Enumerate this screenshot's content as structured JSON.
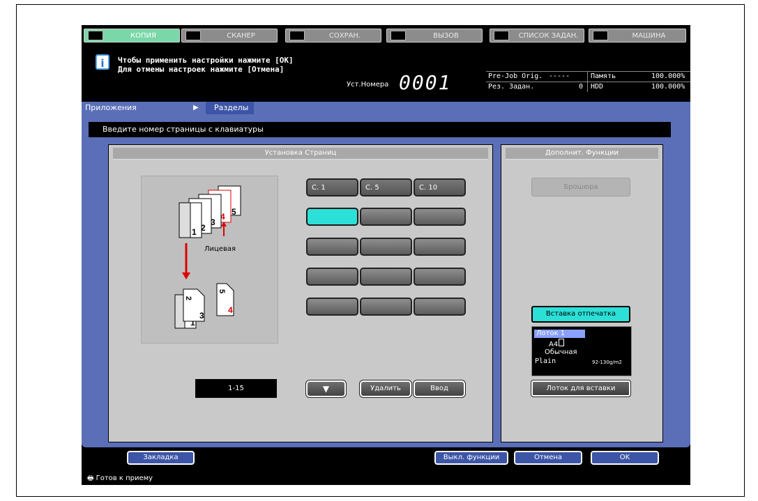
{
  "tabs": [
    {
      "label": "КОПИЯ",
      "icon": "copy-icon",
      "active": true
    },
    {
      "label": "СКАНЕР",
      "icon": "scanner-icon"
    },
    {
      "label": "СОХРАН.",
      "icon": "save-icon"
    },
    {
      "label": "ВЫЗОВ",
      "icon": "recall-icon"
    },
    {
      "label": "СПИСОК ЗАДАН.",
      "icon": "list-icon"
    },
    {
      "label": "МАШИНА",
      "icon": "machine-icon"
    }
  ],
  "message": {
    "line1": "Чтобы применить настройки нажмите [OK]",
    "line2": "Для отмены настроек нажмите [Отмена]",
    "set_label": "Уст.Номера",
    "set_value": "0001"
  },
  "status": {
    "prejob_label": "Pre-Job Orig.",
    "prejob_value": "-----",
    "memory_label": "Память",
    "memory_value": "100.000%",
    "res_label": "Рез. Задан.",
    "res_value": "0",
    "hdd_label": "HDD",
    "hdd_value": "100.000%"
  },
  "breadcrumb": {
    "parent": "Приложения",
    "current": "Разделы"
  },
  "instruction": "Введите номер страницы с клавиатуры",
  "page_setup": {
    "title": "Установка Страниц",
    "face_label": "Лицевая",
    "page_buttons": [
      "С.   1",
      "С.   5",
      "С.   10"
    ],
    "range": "1-15",
    "delete_label": "Удалить",
    "enter_label": "Ввод"
  },
  "extra": {
    "title": "Дополнит. Функции",
    "brochure_label": "Брошюра",
    "insert_label": "Вставка отпечатка",
    "tray": {
      "name": "Лоток 1",
      "size": "A4",
      "type": "Обычная",
      "paper": "Plain",
      "weight": "92-130g/m2"
    },
    "tray_button": "Лоток для вставки"
  },
  "bottom": {
    "bookmark": "Закладка",
    "off_functions": "Выкл. функции",
    "cancel": "Отмена",
    "ok": "OK"
  },
  "statusbar": "Готов к приему",
  "colors": {
    "accent": "#5b6fb8",
    "active_tab": "#7ad8a8",
    "selected": "#2ce0d8"
  }
}
